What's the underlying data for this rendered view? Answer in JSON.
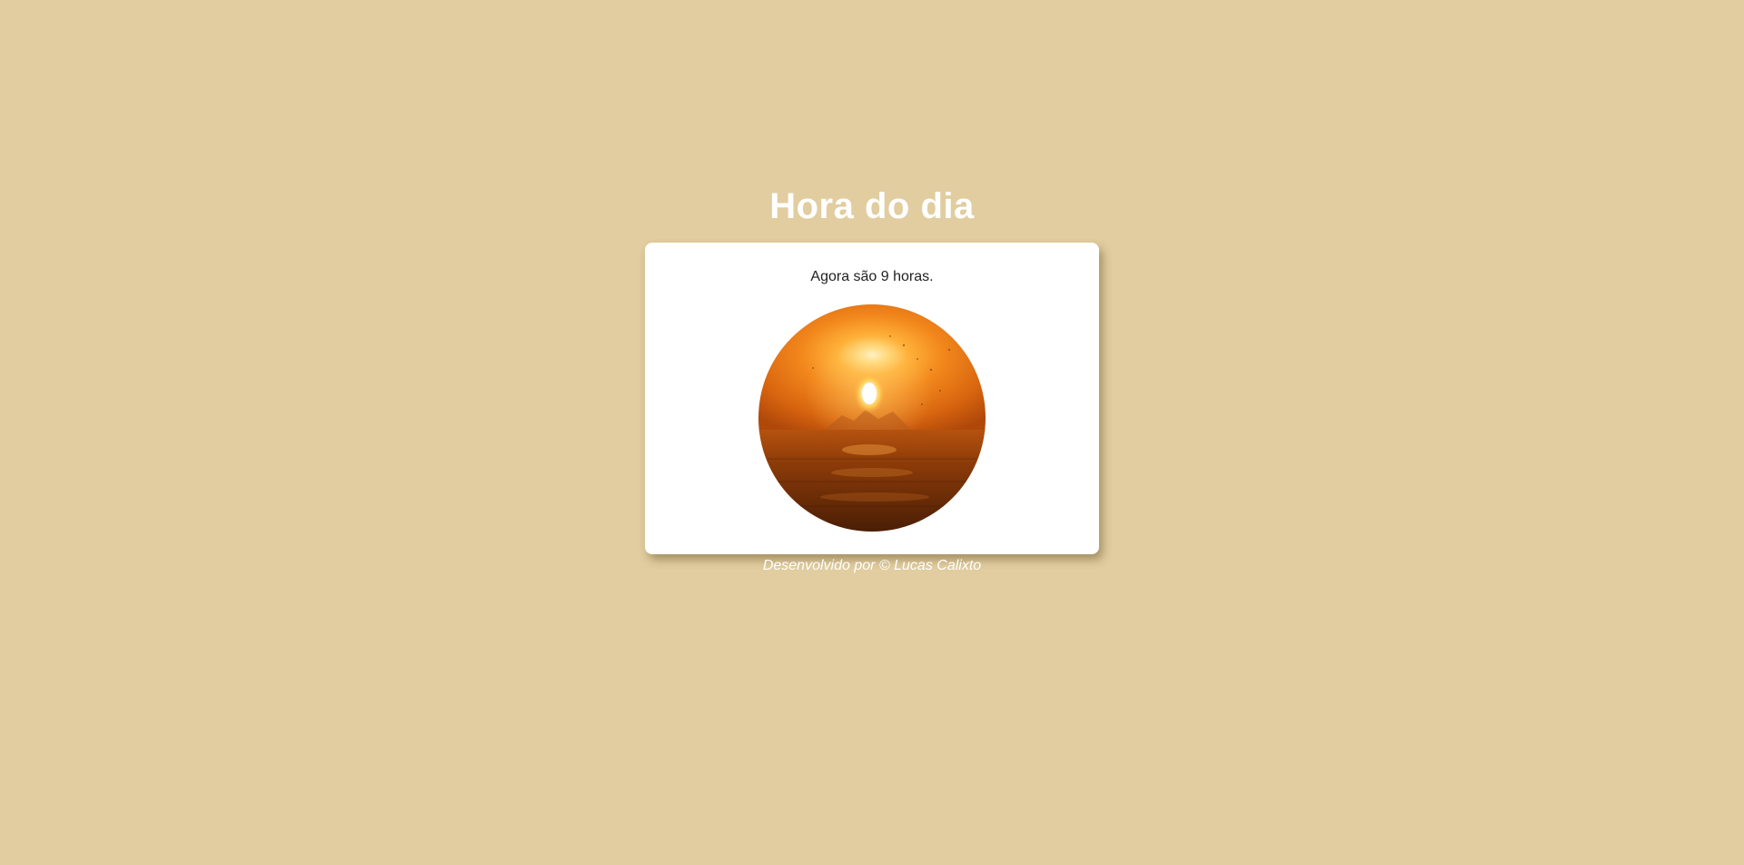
{
  "page": {
    "title": "Hora do dia",
    "background_color": "#e1cd9f"
  },
  "card": {
    "message": "Agora são 9 horas.",
    "image": {
      "icon": "sunrise-photo",
      "description_colors": [
        "#f08a1a",
        "#ffd27a",
        "#5a2a0a"
      ]
    }
  },
  "footer": {
    "text": "Desenvolvido por © Lucas Calixto"
  }
}
